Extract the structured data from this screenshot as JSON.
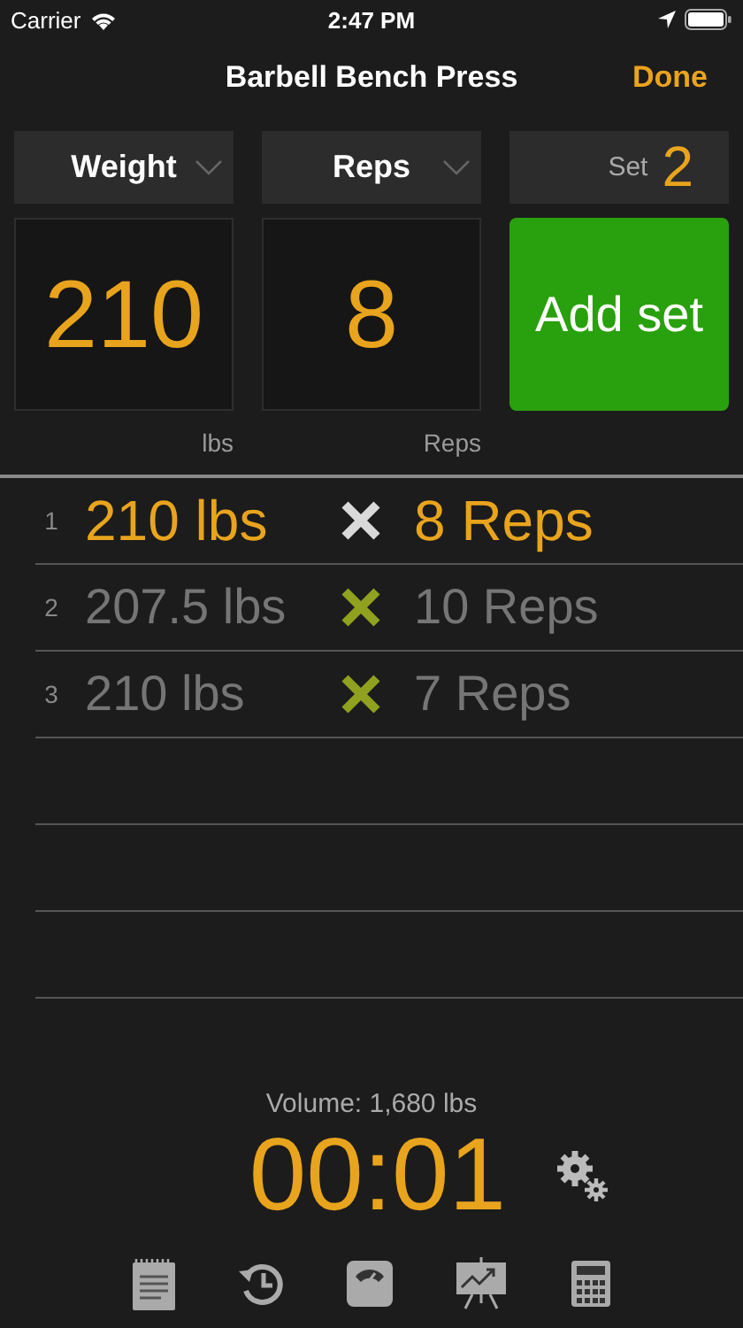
{
  "status_bar": {
    "carrier": "Carrier",
    "time": "2:47 PM"
  },
  "nav": {
    "title": "Barbell Bench Press",
    "done": "Done"
  },
  "pickers": [
    {
      "label": "Weight"
    },
    {
      "label": "Reps"
    }
  ],
  "set": {
    "label": "Set",
    "number": "2"
  },
  "inputs": [
    {
      "value": "210",
      "unit": "lbs"
    },
    {
      "value": "8",
      "unit": "Reps"
    }
  ],
  "add_button": "Add set",
  "sets": [
    {
      "index": "1",
      "weight": "210 lbs",
      "reps": "8 Reps",
      "selected": true
    },
    {
      "index": "2",
      "weight": "207.5 lbs",
      "reps": "10 Reps",
      "selected": false
    },
    {
      "index": "3",
      "weight": "210 lbs",
      "reps": "7 Reps",
      "selected": false
    }
  ],
  "volume": "Volume: 1,680 lbs",
  "timer": "00:01"
}
